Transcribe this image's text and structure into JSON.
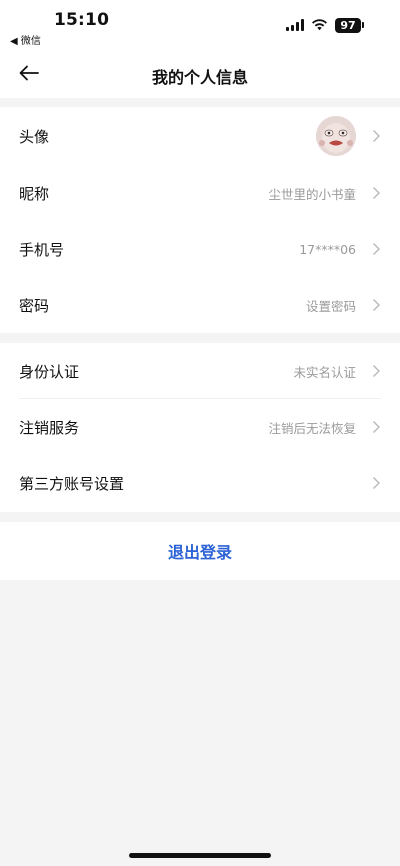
{
  "status_bar": {
    "time": "15:10",
    "back_app_label": "◀ 微信",
    "battery": "97"
  },
  "nav": {
    "back_icon": "arrow-left-icon",
    "title": "我的个人信息"
  },
  "profile": [
    {
      "label": "头像",
      "value": "",
      "type": "avatar"
    },
    {
      "label": "昵称",
      "value": "尘世里的小书童"
    },
    {
      "label": "手机号",
      "value": "17****06"
    },
    {
      "label": "密码",
      "value": "设置密码"
    }
  ],
  "account": [
    {
      "label": "身份认证",
      "value": "未实名认证"
    },
    {
      "label": "注销服务",
      "value": "注销后无法恢复"
    },
    {
      "label": "第三方账号设置",
      "value": ""
    }
  ],
  "logout_label": "退出登录",
  "colors": {
    "accent": "#2c63d6",
    "secondary_text": "#9a9a9a",
    "background": "#f4f4f4"
  }
}
